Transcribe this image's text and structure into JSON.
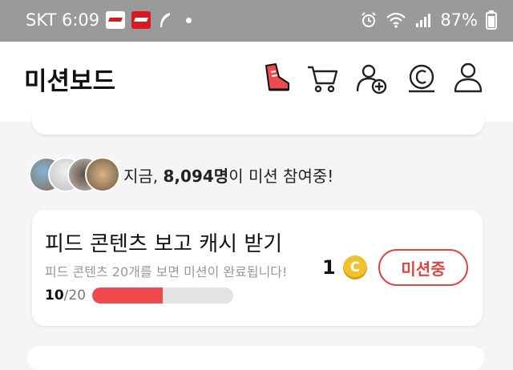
{
  "status_bar": {
    "carrier_time": "SKT 6:09",
    "battery": "87%"
  },
  "header": {
    "title": "미션보드",
    "icons": [
      "shoe-icon",
      "cart-icon",
      "add-friend-icon",
      "coin-icon",
      "profile-icon"
    ]
  },
  "participants": {
    "prefix": "지금, ",
    "count": "8,094명",
    "suffix": "이 미션 참여중!"
  },
  "mission": {
    "title": "피드 콘텐츠 보고 캐시 받기",
    "description": "피드 콘텐츠 20개를 보면 미션이 완료됩니다!",
    "reward": "1",
    "coin_symbol": "C",
    "button_label": "미션중",
    "progress_current": "10",
    "progress_total": "/20",
    "progress_fraction": 0.5
  },
  "colors": {
    "accent": "#e0453d",
    "progress": "#f04a4e",
    "coin": "#f2c12e"
  }
}
